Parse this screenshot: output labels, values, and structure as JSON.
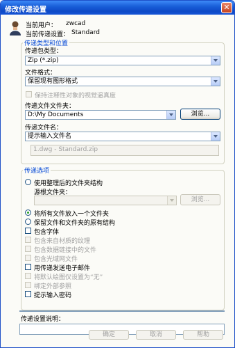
{
  "window": {
    "title": "修改传递设置",
    "close_symbol": "✕"
  },
  "header": {
    "user_label": "当前用户：",
    "user_value": "zwcad",
    "setting_label": "当前传递设置：",
    "setting_value": "Standard"
  },
  "type_location": {
    "legend": "传递类型和位置",
    "package_type_label": "传递包类型：",
    "package_type_value": "Zip (*.zip)",
    "file_format_label": "文件格式：",
    "file_format_value": "保留现有图形格式",
    "preserve_visual_fidelity": "保持注释性对象的视觉逼真度",
    "folder_label": "传递文件文件夹：",
    "folder_value": "D:\\My Documents",
    "browse_label": "浏览...",
    "filename_label": "传递文件名：",
    "filename_value": "提示输入文件名",
    "preview_value": "1.dwg - Standard.zip"
  },
  "options": {
    "legend": "传递选项",
    "use_organized_structure": "使用整理后的文件夹结构",
    "source_root_label": "源根文件夹：",
    "browse_label": "浏览...",
    "put_all_in_one_folder": "将所有文件放入一个文件夹",
    "keep_structure": "保留文件和文件夹的原有结构",
    "checkboxes": [
      {
        "label": "包含字体",
        "enabled": true
      },
      {
        "label": "包含来自材质的纹理",
        "enabled": false
      },
      {
        "label": "包含数据链接中的文件",
        "enabled": false
      },
      {
        "label": "包含光域网文件",
        "enabled": false
      },
      {
        "label": "用传递发送电子邮件",
        "enabled": true
      },
      {
        "label": "将默认绘图仪设置为“无”",
        "enabled": false
      },
      {
        "label": "绑定外部参照",
        "enabled": false
      },
      {
        "label": "提示输入密码",
        "enabled": true
      }
    ]
  },
  "description": {
    "label": "传递设置说明："
  },
  "footer": {
    "ok": "确定",
    "cancel": "取消",
    "help": "帮助"
  }
}
